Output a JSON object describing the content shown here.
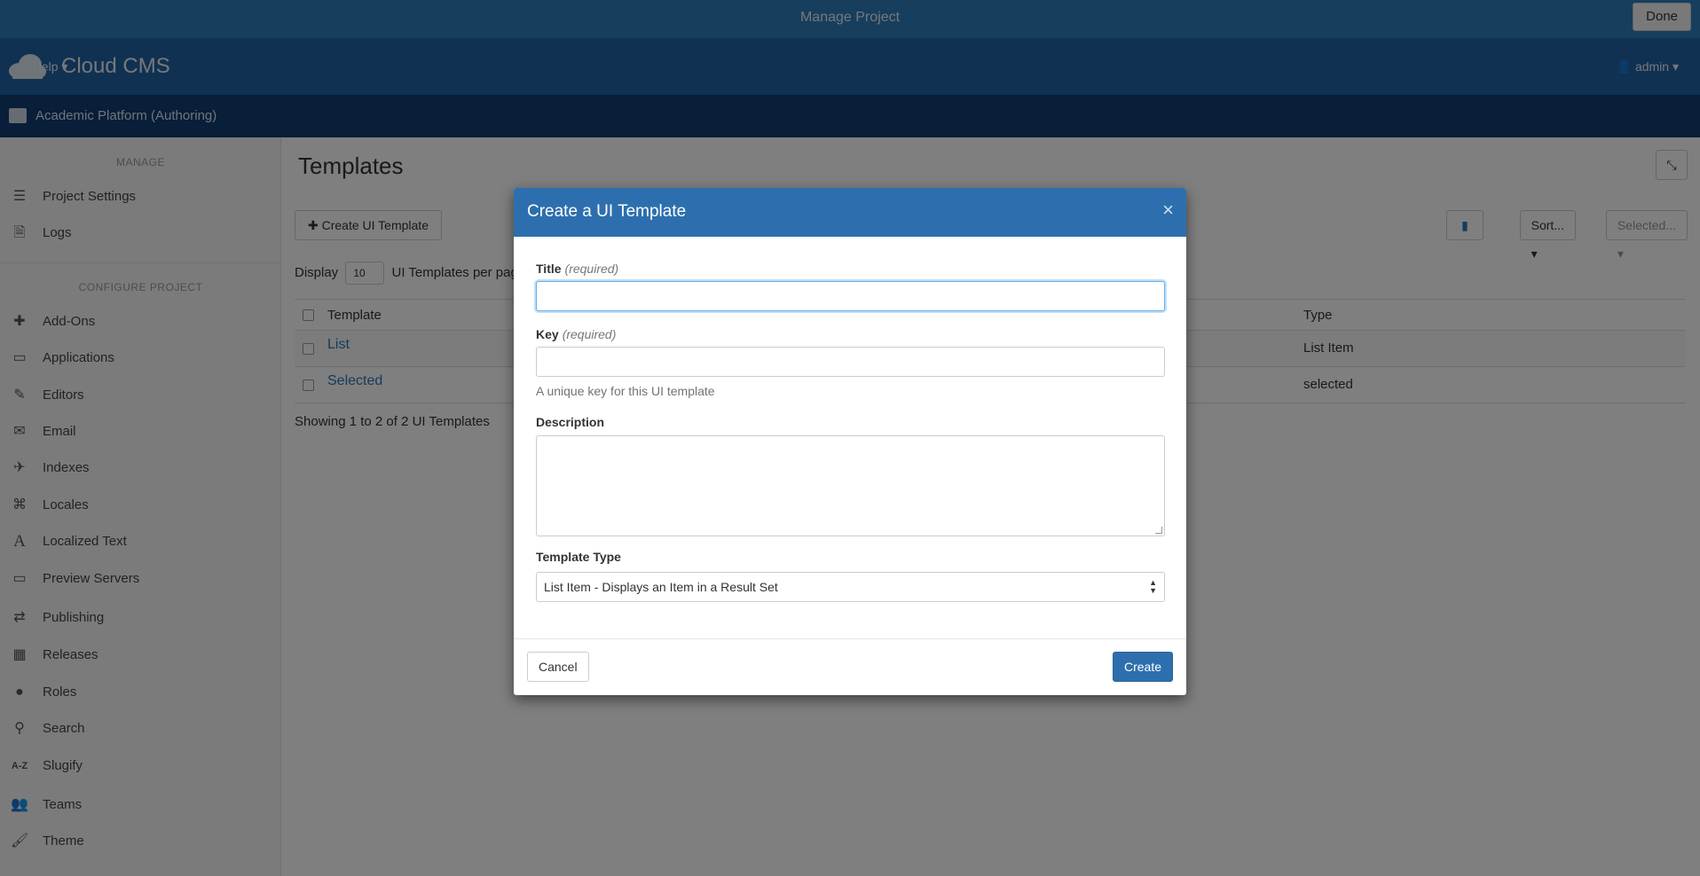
{
  "topbar": {
    "title": "Manage Project",
    "done_label": "Done"
  },
  "header": {
    "brand": "Cloud CMS",
    "help_label": "Help",
    "user_label": "admin"
  },
  "project": {
    "name": "Academic Platform (Authoring)"
  },
  "sidebar": {
    "manage_title": "MANAGE",
    "manage_items": [
      {
        "label": "Project Settings",
        "icon": "sliders-icon"
      },
      {
        "label": "Logs",
        "icon": "file-icon"
      }
    ],
    "configure_title": "CONFIGURE PROJECT",
    "configure_items": [
      {
        "label": "Add-Ons",
        "icon": "puzzle-icon"
      },
      {
        "label": "Applications",
        "icon": "monitor-icon"
      },
      {
        "label": "Editors",
        "icon": "edit-icon"
      },
      {
        "label": "Email",
        "icon": "envelope-icon"
      },
      {
        "label": "Indexes",
        "icon": "plane-icon"
      },
      {
        "label": "Locales",
        "icon": "locale-icon"
      },
      {
        "label": "Localized Text",
        "icon": "font-icon"
      },
      {
        "label": "Preview Servers",
        "icon": "desktop-icon"
      },
      {
        "label": "Publishing",
        "icon": "shuffle-icon"
      },
      {
        "label": "Releases",
        "icon": "calendar-icon"
      },
      {
        "label": "Roles",
        "icon": "user-lock-icon"
      },
      {
        "label": "Search",
        "icon": "search-icon"
      },
      {
        "label": "Slugify",
        "icon": "az-icon"
      },
      {
        "label": "Teams",
        "icon": "users-icon"
      },
      {
        "label": "Theme",
        "icon": "brush-icon"
      }
    ]
  },
  "main": {
    "title": "Templates",
    "create_button": "Create UI Template",
    "sort_label": "Sort...",
    "selected_label": "Selected...",
    "display_prefix": "Display",
    "per_page_value": "10",
    "display_suffix": "UI Templates per page",
    "table": {
      "columns": [
        "Template",
        "Type"
      ],
      "rows": [
        {
          "template": "List",
          "type": "List Item"
        },
        {
          "template": "Selected",
          "type": "selected"
        }
      ]
    },
    "showing": "Showing 1 to 2 of 2 UI Templates"
  },
  "modal": {
    "title": "Create a UI Template",
    "close": "×",
    "title_label": "Title",
    "title_required": "(required)",
    "title_value": "",
    "key_label": "Key",
    "key_required": "(required)",
    "key_value": "",
    "key_help": "A unique key for this UI template",
    "description_label": "Description",
    "description_value": "",
    "type_label": "Template Type",
    "type_value": "List Item - Displays an Item in a Result Set",
    "cancel_label": "Cancel",
    "create_label": "Create"
  }
}
